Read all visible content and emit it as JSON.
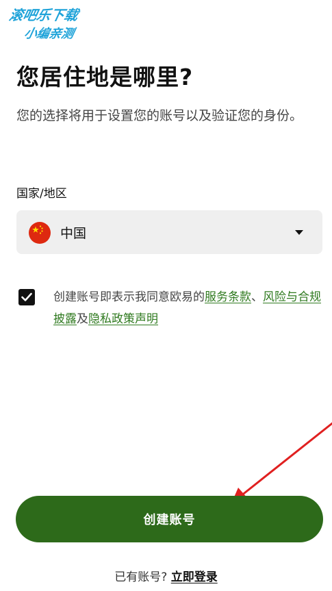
{
  "watermark": {
    "line1": "滚吧乐下载",
    "line2": "小编亲测"
  },
  "heading": "您居住地是哪里?",
  "subtitle": "您的选择将用于设置您的账号以及验证您的身份。",
  "country_field": {
    "label": "国家/地区",
    "selected_value": "中国",
    "flag_icon": "china-flag-icon",
    "caret_icon": "caret-down-icon"
  },
  "agreement": {
    "checked": true,
    "prefix": "创建账号即表示我同意欧易的",
    "link_terms": "服务条款",
    "separator": "、",
    "link_risk": "风险与合规披露",
    "conjunction": "及",
    "link_privacy": "隐私政策声明"
  },
  "create_button_label": "创建账号",
  "login_prompt": {
    "text": "已有账号?",
    "link": "立即登录"
  },
  "colors": {
    "primary_green": "#2d6a1a",
    "link_green": "#2f7a1f",
    "field_bg": "#efefef",
    "annotation_arrow": "#e02020",
    "flag_red": "#de2910",
    "flag_star": "#ffde00"
  }
}
